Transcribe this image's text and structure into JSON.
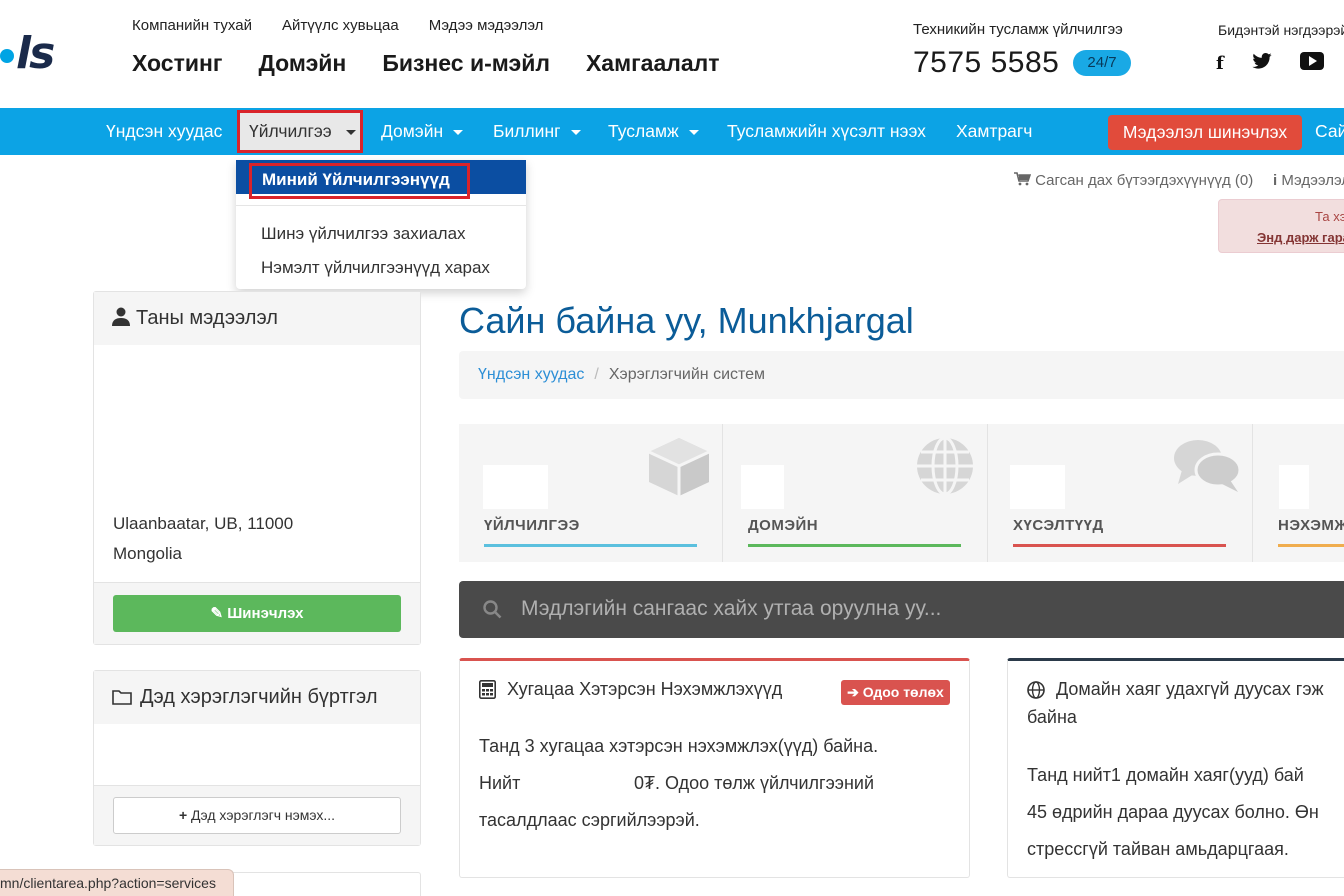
{
  "header": {
    "logo_text": "ls",
    "small_nav": [
      "Компанийн тухай",
      "Айтүүлс хувьцаа",
      "Мэдээ мэдээлэл"
    ],
    "big_nav": [
      "Хостинг",
      "Домэйн",
      "Бизнес и-мэйл",
      "Хамгаалалт"
    ],
    "support_label": "Техникийн тусламж үйлчилгээ",
    "phone": "7575 5585",
    "badge": "24/7",
    "social_label": "Бидэнтэй нэгдээрэй",
    "social": [
      "f",
      "t",
      "▶"
    ]
  },
  "navbar": {
    "home": "Үндсэн хуудас",
    "services": "Үйлчилгээ",
    "domain": "Домэйн",
    "billing": "Биллинг",
    "help": "Тусламж",
    "ticket": "Тусламжийн хүсэлт нээх",
    "partner": "Хамтрагч",
    "update_button": "Мэдээлэл шинэчлэх",
    "trailing": "Сайн"
  },
  "dropdown": {
    "active": "Миний Үйлчилгээнүүд",
    "items": [
      "Шинэ үйлчилгээ захиалах",
      "Нэмэлт үйлчилгээнүүд харах"
    ]
  },
  "toolbar": {
    "cart": "Сагсан дах бүтээгдэхүүнүүд (0)",
    "info": "Мэдээлэл"
  },
  "alert": {
    "line1": "Та хэрэг",
    "line2": "Энд дарж гарах"
  },
  "profile_panel": {
    "title": "Таны мэдээлэл",
    "address1": "Ulaanbaatar, UB, 11000",
    "address2": "Mongolia",
    "edit_button": "Шинэчлэх"
  },
  "subaccount_panel": {
    "title": "Дэд хэрэглэгчийн бүртгэл",
    "add_button": "Дэд хэрэглэгч нэмэх..."
  },
  "main": {
    "welcome": "Сайн байна уу, Munkhjargal",
    "breadcrumb_home": "Үндсэн хуудас",
    "breadcrumb_current": "Хэрэглэгчийн систем",
    "tiles": [
      {
        "label": "ҮЙЛЧИЛГЭЭ",
        "color": "#5bc0de"
      },
      {
        "label": "ДОМЭЙН",
        "color": "#5cb85c"
      },
      {
        "label": "ХҮСЭЛТҮҮД",
        "color": "#d9534f"
      },
      {
        "label": "НЭХЭМЖЛЭХ",
        "color": "#f0ad4e"
      }
    ],
    "search_placeholder": "Мэдлэгийн сангаас хайх утгаа оруулна уу..."
  },
  "invoice_card": {
    "title": "Хугацаа Хэтэрсэн Нэхэмжлэхүүд",
    "pay_button": "Одоо төлөх",
    "line1": "Танд 3 хугацаа хэтэрсэн нэхэмжлэх(үүд) байна.",
    "line2a": "Нийт",
    "line2b": "0₮. Одоо төлж үйлчилгээний",
    "line3": "тасалдлаас сэргийлээрэй."
  },
  "domain_card": {
    "title1": "Домайн хаяг удахгүй дуусах гэж",
    "title2": "байна",
    "line1": "Танд нийт1 домайн хаяг(ууд) бай",
    "line2": "45 өдрийн дараа дуусах болно. Өн",
    "line3": "стрессгүй тайван амьдарцгаая."
  },
  "statusbar": {
    "url": "mn/clientarea.php?action=services"
  },
  "colors": {
    "nav_blue": "#0ca3e5",
    "dropdown_blue": "#0b4ea2",
    "highlight_red": "#d9232a",
    "update_red": "#e14b3b",
    "edit_green": "#5cb85c"
  }
}
